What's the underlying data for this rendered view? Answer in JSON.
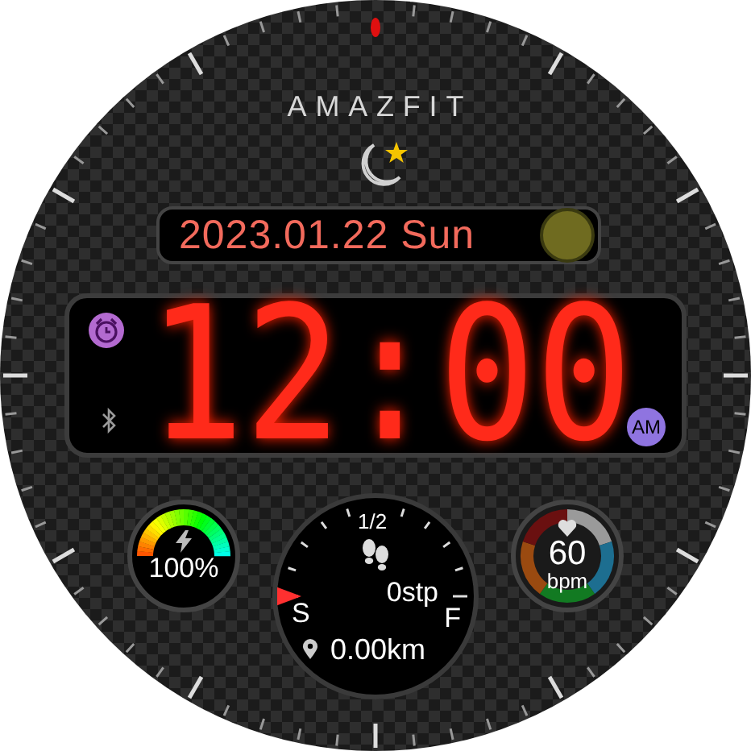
{
  "brand": "AMAZFIT",
  "date": {
    "text": "2023.01.22 Sun"
  },
  "time": {
    "text": "12:00",
    "period": "AM"
  },
  "battery": {
    "reading": "100%"
  },
  "steps": {
    "scale_mid": "1/2",
    "start": "S",
    "end": "F",
    "count": "0stp",
    "distance": "0.00km"
  },
  "heart_rate": {
    "value": "60",
    "unit": "bpm"
  }
}
